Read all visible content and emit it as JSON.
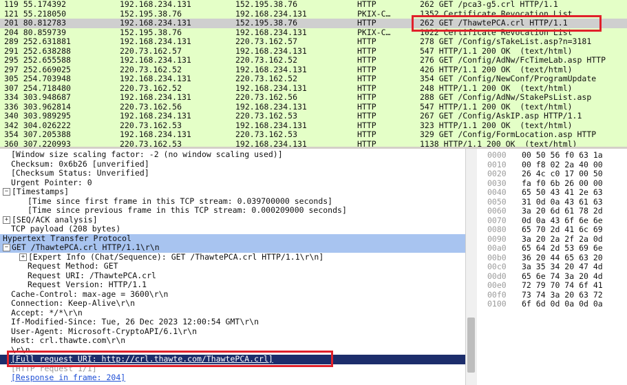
{
  "packet_list": [
    {
      "no": "119 55.174392",
      "src": "192.168.234.131",
      "dst": "152.195.38.76",
      "proto": "HTTP",
      "info": "262 GET /pca3-g5.crl HTTP/1.1",
      "style": "green"
    },
    {
      "no": "121 55.218050",
      "src": "152.195.38.76",
      "dst": "192.168.234.131",
      "proto": "PKIX-C…",
      "info": "1352 Certificate Revocation List",
      "style": "green"
    },
    {
      "no": "201 80.812783",
      "src": "192.168.234.131",
      "dst": "152.195.38.76",
      "proto": "HTTP",
      "info": "262 GET /ThawtePCA.crl HTTP/1.1",
      "style": "selected"
    },
    {
      "no": "204 80.859739",
      "src": "152.195.38.76",
      "dst": "192.168.234.131",
      "proto": "PKIX-C…",
      "info": "1022 Certificate Revocation List",
      "style": "green"
    },
    {
      "no": "289 252.631881",
      "src": "192.168.234.131",
      "dst": "220.73.162.57",
      "proto": "HTTP",
      "info": "278 GET /Config/sTakeList.asp?n=3181",
      "style": "green"
    },
    {
      "no": "291 252.638288",
      "src": "220.73.162.57",
      "dst": "192.168.234.131",
      "proto": "HTTP",
      "info": "547 HTTP/1.1 200 OK  (text/html)",
      "style": "green"
    },
    {
      "no": "295 252.655588",
      "src": "192.168.234.131",
      "dst": "220.73.162.52",
      "proto": "HTTP",
      "info": "276 GET /Config/AdNw/FcTimeLab.asp HTTP",
      "style": "green"
    },
    {
      "no": "297 252.669025",
      "src": "220.73.162.52",
      "dst": "192.168.234.131",
      "proto": "HTTP",
      "info": "426 HTTP/1.1 200 OK  (text/html)",
      "style": "green"
    },
    {
      "no": "305 254.703948",
      "src": "192.168.234.131",
      "dst": "220.73.162.52",
      "proto": "HTTP",
      "info": "354 GET /Config/NewConf/ProgramUpdate",
      "style": "green"
    },
    {
      "no": "307 254.718480",
      "src": "220.73.162.52",
      "dst": "192.168.234.131",
      "proto": "HTTP",
      "info": "248 HTTP/1.1 200 OK  (text/html)",
      "style": "green"
    },
    {
      "no": "334 303.948687",
      "src": "192.168.234.131",
      "dst": "220.73.162.56",
      "proto": "HTTP",
      "info": "288 GET /Config/AdNw/StakePsList.asp",
      "style": "green"
    },
    {
      "no": "336 303.962814",
      "src": "220.73.162.56",
      "dst": "192.168.234.131",
      "proto": "HTTP",
      "info": "547 HTTP/1.1 200 OK  (text/html)",
      "style": "green"
    },
    {
      "no": "340 303.989295",
      "src": "192.168.234.131",
      "dst": "220.73.162.53",
      "proto": "HTTP",
      "info": "267 GET /Config/AskIP.asp HTTP/1.1",
      "style": "green"
    },
    {
      "no": "342 304.026222",
      "src": "220.73.162.53",
      "dst": "192.168.234.131",
      "proto": "HTTP",
      "info": "323 HTTP/1.1 200 OK  (text/html)",
      "style": "green"
    },
    {
      "no": "354 307.205388",
      "src": "192.168.234.131",
      "dst": "220.73.162.53",
      "proto": "HTTP",
      "info": "329 GET /Config/FormLocation.asp HTTP",
      "style": "green"
    },
    {
      "no": "360 307.220993",
      "src": "220.73.162.53",
      "dst": "192.168.234.131",
      "proto": "HTTP",
      "info": "1138 HTTP/1.1 200 OK  (text/html)",
      "style": "green"
    }
  ],
  "details_tree": [
    {
      "text": "[Window size scaling factor: -2 (no window scaling used)]",
      "indent": 1,
      "expander": ""
    },
    {
      "text": "Checksum: 0x6b26 [unverified]",
      "indent": 1,
      "expander": ""
    },
    {
      "text": "[Checksum Status: Unverified]",
      "indent": 1,
      "expander": ""
    },
    {
      "text": "Urgent Pointer: 0",
      "indent": 1,
      "expander": ""
    },
    {
      "text": "[Timestamps]",
      "indent": 0,
      "expander": "−"
    },
    {
      "text": "[Time since first frame in this TCP stream: 0.039700000 seconds]",
      "indent": 3,
      "expander": ""
    },
    {
      "text": "[Time since previous frame in this TCP stream: 0.000209000 seconds]",
      "indent": 3,
      "expander": ""
    },
    {
      "text": "[SEQ/ACK analysis]",
      "indent": 0,
      "expander": "+"
    },
    {
      "text": "TCP payload (208 bytes)",
      "indent": 1,
      "expander": ""
    },
    {
      "text": "Hypertext Transfer Protocol",
      "indent": 0,
      "expander": "",
      "style": "hl"
    },
    {
      "text": "GET /ThawtePCA.crl HTTP/1.1\\r\\n",
      "indent": 0,
      "expander": "−",
      "style": "hl"
    },
    {
      "text": "[Expert Info (Chat/Sequence): GET /ThawtePCA.crl HTTP/1.1\\r\\n]",
      "indent": 2,
      "expander": "+"
    },
    {
      "text": "Request Method: GET",
      "indent": 3,
      "expander": ""
    },
    {
      "text": "Request URI: /ThawtePCA.crl",
      "indent": 3,
      "expander": ""
    },
    {
      "text": "Request Version: HTTP/1.1",
      "indent": 3,
      "expander": ""
    },
    {
      "text": "Cache-Control: max-age = 3600\\r\\n",
      "indent": 1,
      "expander": ""
    },
    {
      "text": "Connection: Keep-Alive\\r\\n",
      "indent": 1,
      "expander": ""
    },
    {
      "text": "Accept: */*\\r\\n",
      "indent": 1,
      "expander": ""
    },
    {
      "text": "If-Modified-Since: Tue, 26 Dec 2023 12:00:54 GMT\\r\\n",
      "indent": 1,
      "expander": ""
    },
    {
      "text": "User-Agent: Microsoft-CryptoAPI/6.1\\r\\n",
      "indent": 1,
      "expander": ""
    },
    {
      "text": "Host: crl.thawte.com\\r\\n",
      "indent": 1,
      "expander": ""
    },
    {
      "text": "\\r\\n",
      "indent": 1,
      "expander": ""
    },
    {
      "text": "[Full request URI: http://crl.thawte.com/ThawtePCA.crl]",
      "indent": 1,
      "expander": "",
      "style": "sel",
      "link": true
    },
    {
      "text": "[HTTP request 1/1]",
      "indent": 1,
      "expander": "",
      "style": "dim"
    },
    {
      "text": "[Response in frame: 204]",
      "indent": 1,
      "expander": "",
      "link": true
    }
  ],
  "hex_dump": [
    {
      "offset": "0000",
      "bytes": "00 50 56 f0 63 1a"
    },
    {
      "offset": "0010",
      "bytes": "00 f8 02 2a 40 00"
    },
    {
      "offset": "0020",
      "bytes": "26 4c c0 17 00 50"
    },
    {
      "offset": "0030",
      "bytes": "fa f0 6b 26 00 00"
    },
    {
      "offset": "0040",
      "bytes": "65 50 43 41 2e 63"
    },
    {
      "offset": "0050",
      "bytes": "31 0d 0a 43 61 63"
    },
    {
      "offset": "0060",
      "bytes": "3a 20 6d 61 78 2d"
    },
    {
      "offset": "0070",
      "bytes": "0d 0a 43 6f 6e 6e"
    },
    {
      "offset": "0080",
      "bytes": "65 70 2d 41 6c 69"
    },
    {
      "offset": "0090",
      "bytes": "3a 20 2a 2f 2a 0d"
    },
    {
      "offset": "00a0",
      "bytes": "65 64 2d 53 69 6e"
    },
    {
      "offset": "00b0",
      "bytes": "36 20 44 65 63 20"
    },
    {
      "offset": "00c0",
      "bytes": "3a 35 34 20 47 4d"
    },
    {
      "offset": "00d0",
      "bytes": "65 6e 74 3a 20 4d"
    },
    {
      "offset": "00e0",
      "bytes": "72 79 70 74 6f 41"
    },
    {
      "offset": "00f0",
      "bytes": "73 74 3a 20 63 72"
    },
    {
      "offset": "0100",
      "bytes": "6f 6d 0d 0a 0d 0a"
    }
  ],
  "colors": {
    "highlight_box": "#e0202a",
    "row_green": "#e4ffc7",
    "row_selected": "#cfcfcf",
    "http_section": "#a8c4f0",
    "selected_field": "#1c2d6b"
  }
}
